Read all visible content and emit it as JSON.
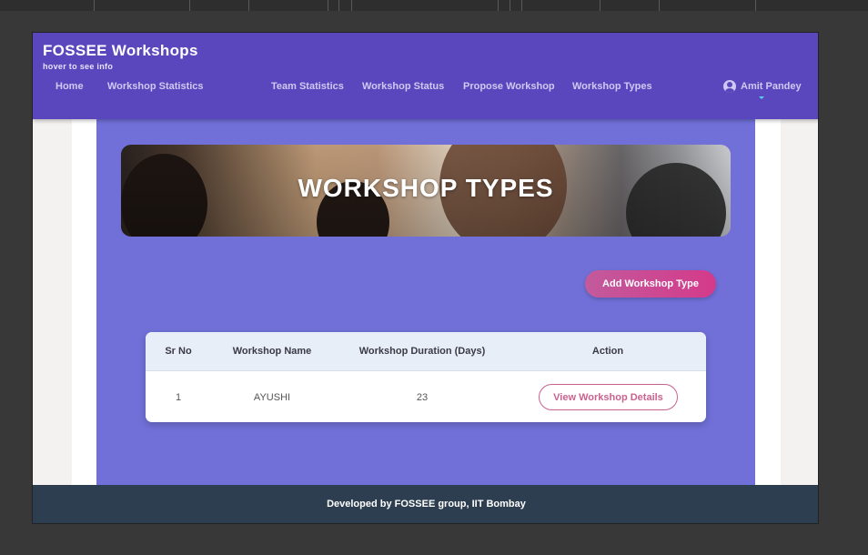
{
  "navbar": {
    "brand": "FOSSEE Workshops",
    "brand_sub": "hover to see info",
    "links": [
      "Home",
      "Workshop Statistics",
      "Team Statistics",
      "Workshop Status",
      "Propose Workshop",
      "Workshop Types"
    ],
    "user_name": "Amit Pandey",
    "color": "#5b47bd"
  },
  "banner": {
    "title": "WORKSHOP TYPES"
  },
  "add_button": {
    "label": "Add Workshop Type"
  },
  "table": {
    "headers": [
      "Sr No",
      "Workshop Name",
      "Workshop Duration (Days)",
      "Action"
    ],
    "rows": [
      {
        "sr_no": "1",
        "name": "AYUSHI",
        "duration": "23",
        "action_label": "View Workshop Details"
      }
    ]
  },
  "footer": {
    "text": "Developed by FOSSEE group, IIT Bombay"
  },
  "colors": {
    "content_bg": "#7070d8",
    "accent_pink": "#d43a8a",
    "footer_bg": "#2c3e50"
  },
  "icons": {
    "user": "account-circle-icon",
    "dropdown": "caret-down-icon"
  }
}
